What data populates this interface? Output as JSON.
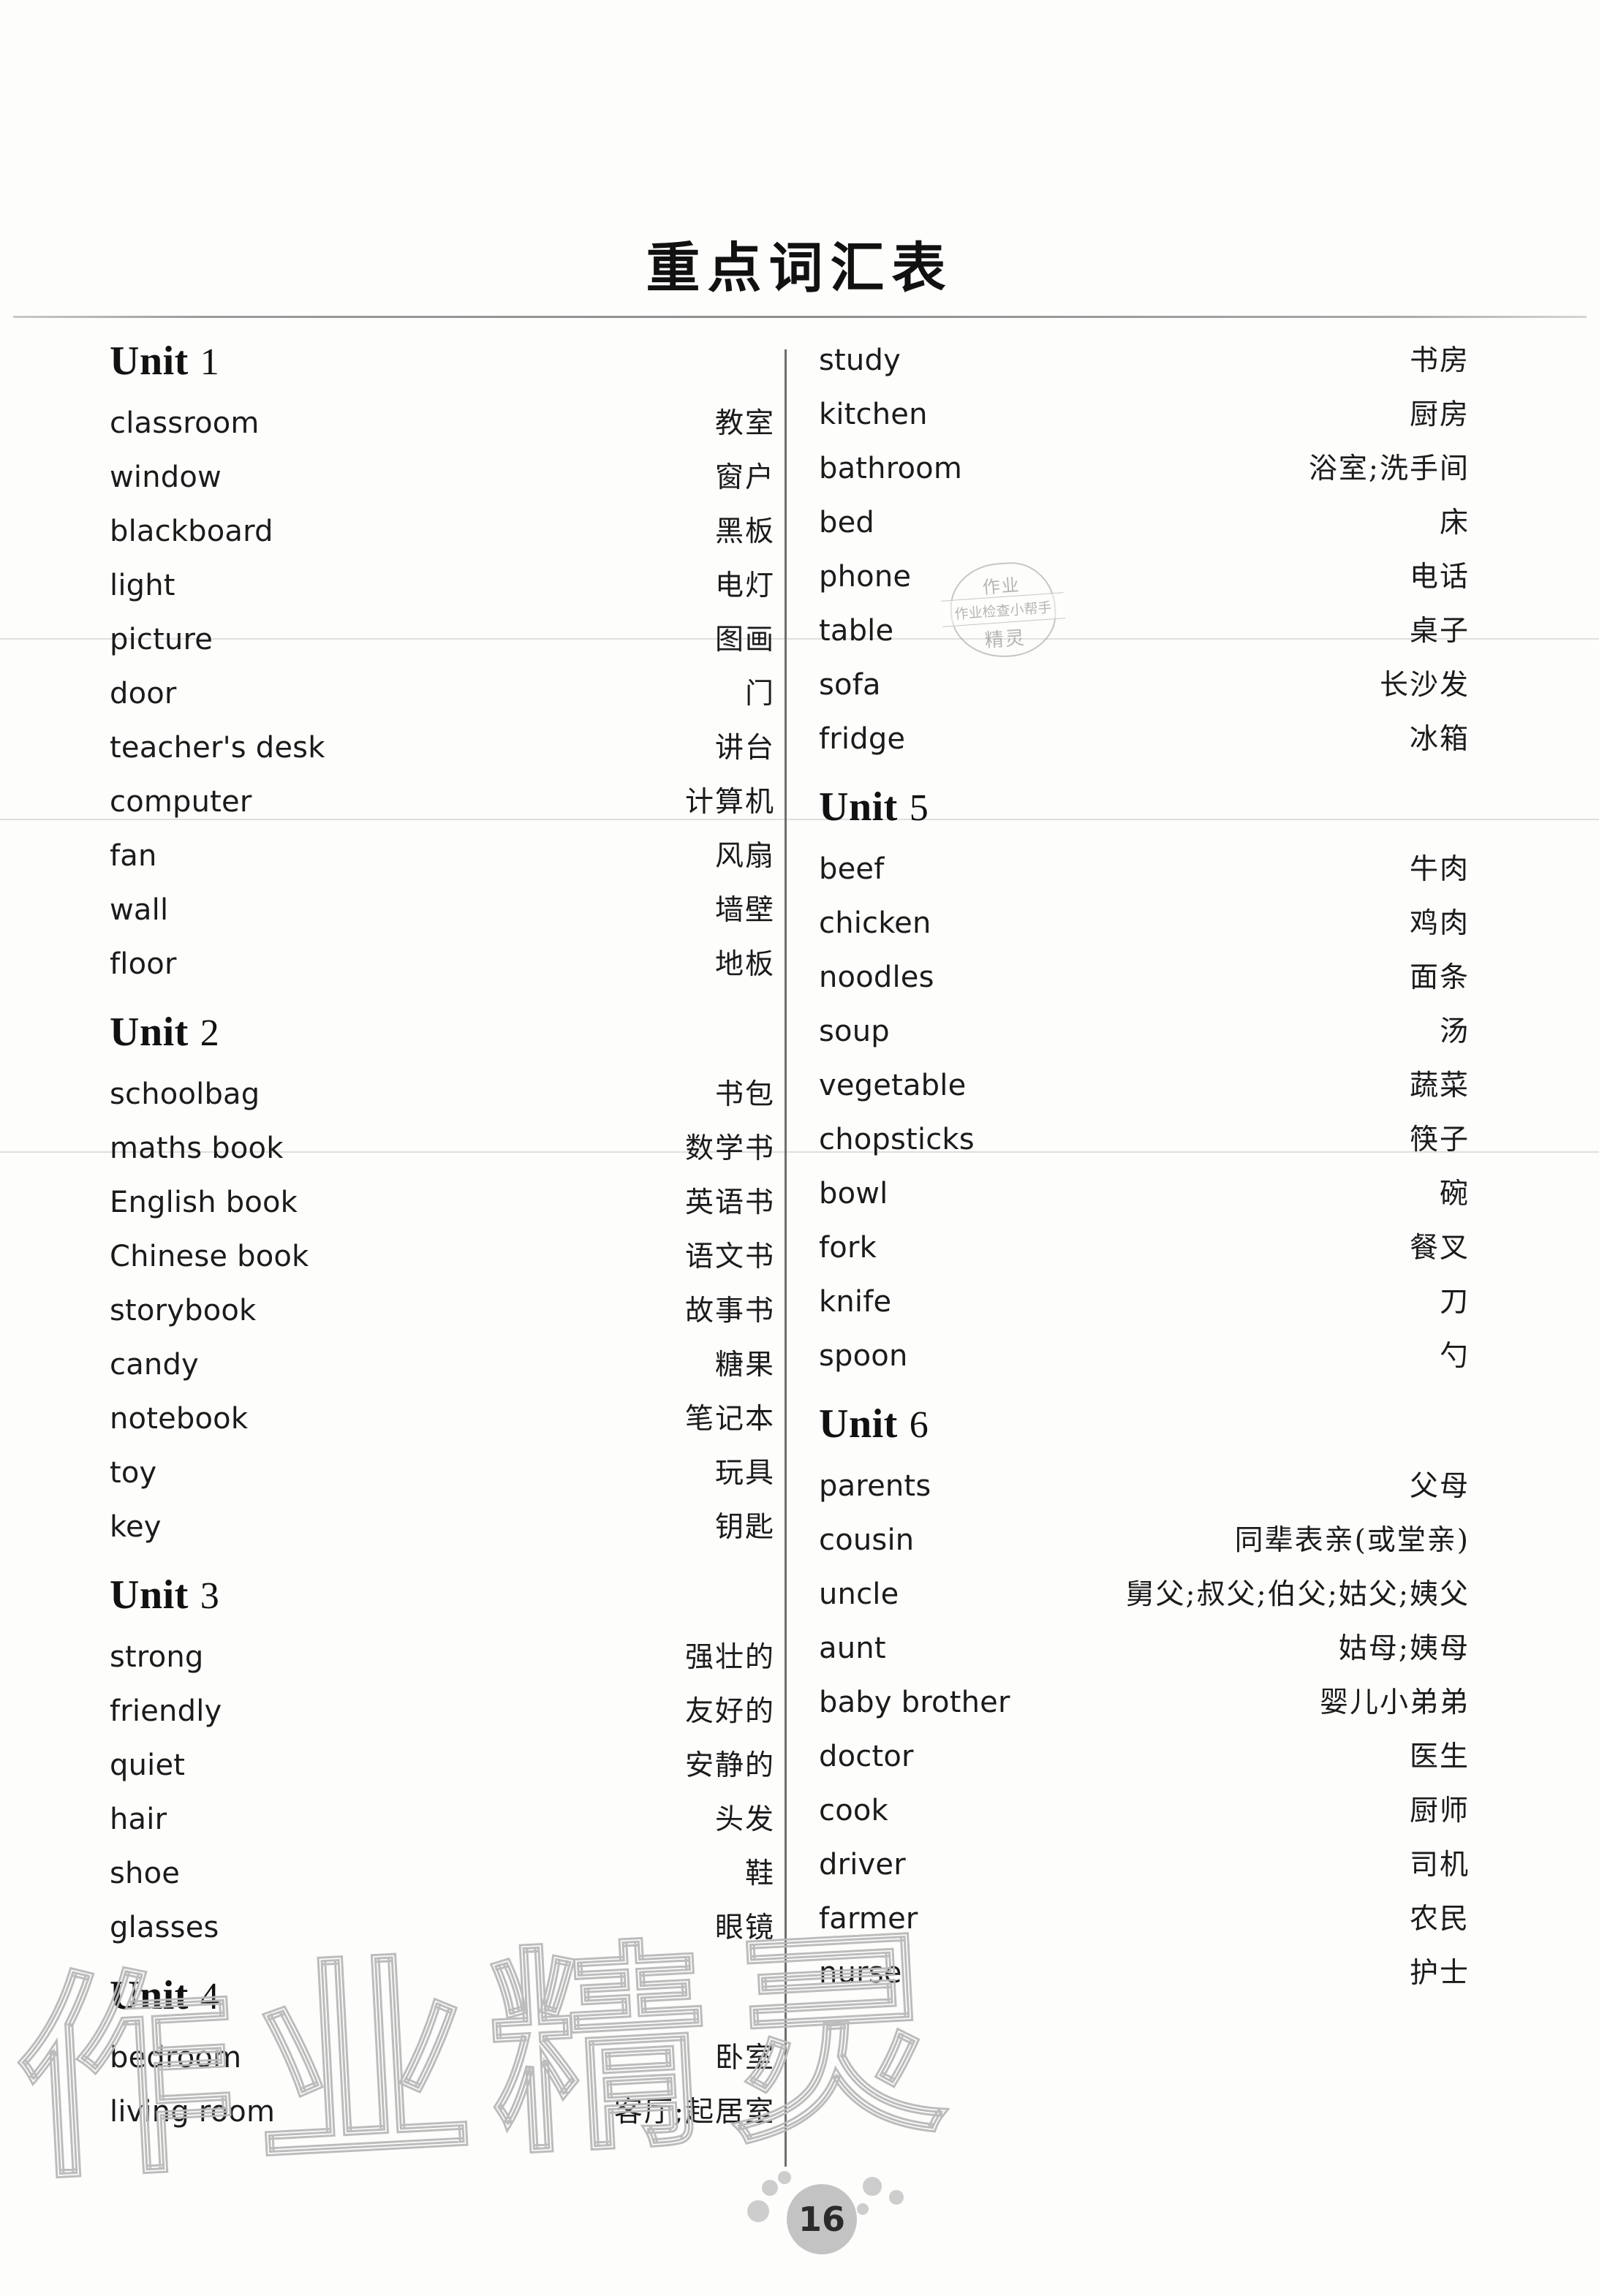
{
  "page": {
    "title": "重点词汇表",
    "page_number": "16",
    "watermark_text": "作业精灵"
  },
  "stamp": {
    "top": "作业",
    "middle": "作业检查小帮手",
    "bottom": "精灵"
  },
  "columns": {
    "left": [
      {
        "type": "unit",
        "word": "Unit",
        "number": "1",
        "entries": [
          {
            "en": "classroom",
            "zh": "教室"
          },
          {
            "en": "window",
            "zh": "窗户"
          },
          {
            "en": "blackboard",
            "zh": "黑板"
          },
          {
            "en": "light",
            "zh": "电灯"
          },
          {
            "en": "picture",
            "zh": "图画"
          },
          {
            "en": "door",
            "zh": "门"
          },
          {
            "en": "teacher's desk",
            "zh": "讲台"
          },
          {
            "en": "computer",
            "zh": "计算机"
          },
          {
            "en": "fan",
            "zh": "风扇"
          },
          {
            "en": "wall",
            "zh": "墙壁"
          },
          {
            "en": "floor",
            "zh": "地板"
          }
        ]
      },
      {
        "type": "unit",
        "word": "Unit",
        "number": "2",
        "entries": [
          {
            "en": "schoolbag",
            "zh": "书包"
          },
          {
            "en": "maths book",
            "zh": "数学书"
          },
          {
            "en": "English book",
            "zh": "英语书"
          },
          {
            "en": "Chinese book",
            "zh": "语文书"
          },
          {
            "en": "storybook",
            "zh": "故事书"
          },
          {
            "en": "candy",
            "zh": "糖果"
          },
          {
            "en": "notebook",
            "zh": "笔记本"
          },
          {
            "en": "toy",
            "zh": "玩具"
          },
          {
            "en": "key",
            "zh": "钥匙"
          }
        ]
      },
      {
        "type": "unit",
        "word": "Unit",
        "number": "3",
        "entries": [
          {
            "en": "strong",
            "zh": "强壮的"
          },
          {
            "en": "friendly",
            "zh": "友好的"
          },
          {
            "en": "quiet",
            "zh": "安静的"
          },
          {
            "en": "hair",
            "zh": "头发"
          },
          {
            "en": "shoe",
            "zh": "鞋"
          },
          {
            "en": "glasses",
            "zh": "眼镜"
          }
        ]
      },
      {
        "type": "unit",
        "word": "Unit",
        "number": "4",
        "entries": [
          {
            "en": "bedroom",
            "zh": "卧室"
          },
          {
            "en": "living room",
            "zh": "客厅;起居室"
          }
        ]
      }
    ],
    "right": [
      {
        "type": "continuation",
        "entries": [
          {
            "en": "study",
            "zh": "书房"
          },
          {
            "en": "kitchen",
            "zh": "厨房"
          },
          {
            "en": "bathroom",
            "zh": "浴室;洗手间"
          },
          {
            "en": "bed",
            "zh": "床"
          },
          {
            "en": "phone",
            "zh": "电话"
          },
          {
            "en": "table",
            "zh": "桌子"
          },
          {
            "en": "sofa",
            "zh": "长沙发"
          },
          {
            "en": "fridge",
            "zh": "冰箱"
          }
        ]
      },
      {
        "type": "unit",
        "word": "Unit",
        "number": "5",
        "entries": [
          {
            "en": "beef",
            "zh": "牛肉"
          },
          {
            "en": "chicken",
            "zh": "鸡肉"
          },
          {
            "en": "noodles",
            "zh": "面条"
          },
          {
            "en": "soup",
            "zh": "汤"
          },
          {
            "en": "vegetable",
            "zh": "蔬菜"
          },
          {
            "en": "chopsticks",
            "zh": "筷子"
          },
          {
            "en": "bowl",
            "zh": "碗"
          },
          {
            "en": "fork",
            "zh": "餐叉"
          },
          {
            "en": "knife",
            "zh": "刀"
          },
          {
            "en": "spoon",
            "zh": "勺"
          }
        ]
      },
      {
        "type": "unit",
        "word": "Unit",
        "number": "6",
        "entries": [
          {
            "en": "parents",
            "zh": "父母"
          },
          {
            "en": "cousin",
            "zh": "同辈表亲(或堂亲)"
          },
          {
            "en": "uncle",
            "zh": "舅父;叔父;伯父;姑父;姨父"
          },
          {
            "en": "aunt",
            "zh": "姑母;姨母"
          },
          {
            "en": "baby brother",
            "zh": "婴儿小弟弟"
          },
          {
            "en": "doctor",
            "zh": "医生"
          },
          {
            "en": "cook",
            "zh": "厨师"
          },
          {
            "en": "driver",
            "zh": "司机"
          },
          {
            "en": "farmer",
            "zh": "农民"
          },
          {
            "en": "nurse",
            "zh": "护士"
          }
        ]
      }
    ]
  }
}
